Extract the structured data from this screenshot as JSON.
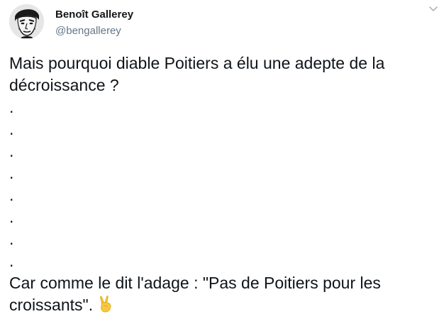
{
  "author": {
    "display_name": "Benoît Gallerey",
    "handle": "@bengallerey"
  },
  "header": {
    "menu_icon": "chevron-down-icon"
  },
  "tweet": {
    "line1": "Mais pourquoi diable Poitiers a élu une adepte de la",
    "line2": "décroissance ?",
    "dots": [
      ".",
      ".",
      ".",
      ".",
      ".",
      ".",
      ".",
      "."
    ],
    "line3": "Car comme le dit l'adage : \"Pas de Poitiers pour les",
    "line4": "croissants\".",
    "emoji": "victory-hand-icon"
  }
}
